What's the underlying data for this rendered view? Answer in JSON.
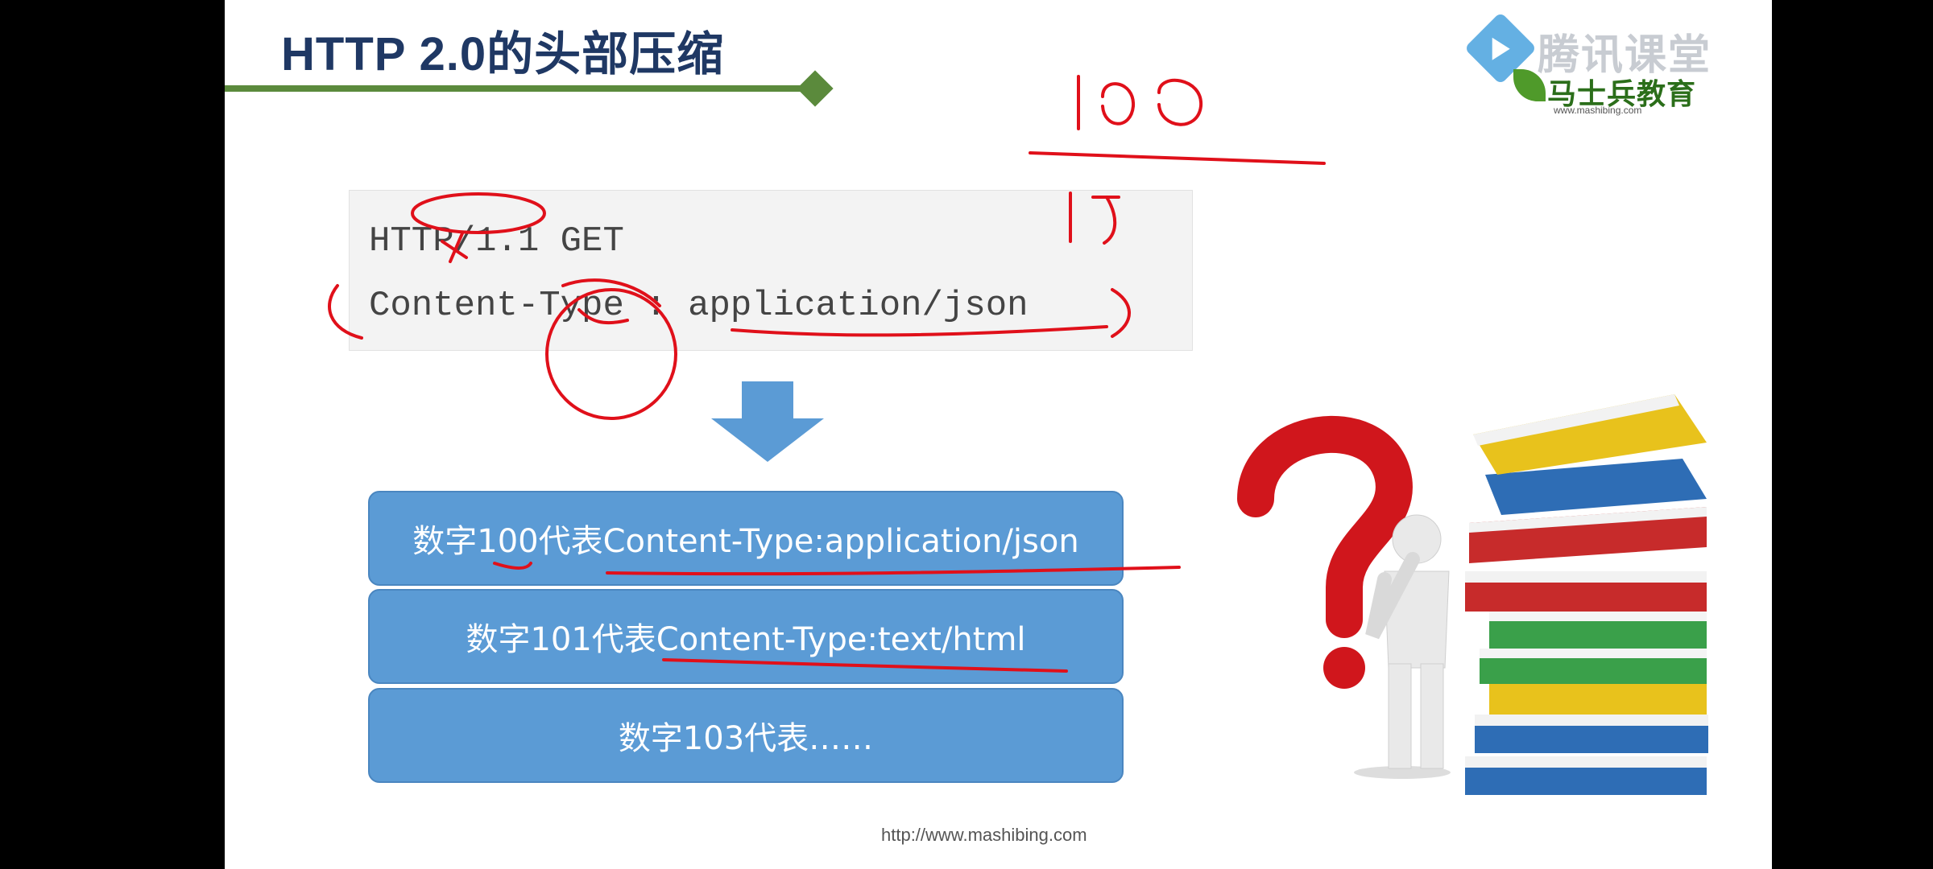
{
  "slide": {
    "title": "HTTP 2.0的头部压缩",
    "logo": {
      "brand": "腾讯课堂",
      "school": "马士兵教育",
      "url": "www.mashibing.com"
    },
    "code": {
      "line1": "HTTP/1.1 GET",
      "line2": "Content-Type : application/json"
    },
    "mappings": [
      {
        "text": "数字100代表Content-Type:application/json"
      },
      {
        "text": "数字101代表Content-Type:text/html"
      },
      {
        "text": "数字103代表……"
      }
    ],
    "footer_url": "http://www.mashibing.com",
    "annotations": {
      "number": "100"
    }
  },
  "colors": {
    "title": "#1f3864",
    "rule": "#5b8a3c",
    "mapping_fill": "#5b9bd5",
    "arrow": "#5b9bd5",
    "ink": "#e0101a"
  },
  "icons": {
    "arrow": "down-arrow-icon",
    "illustration": "question-mark-books-illustration",
    "logo": "tencent-classroom-logo"
  }
}
